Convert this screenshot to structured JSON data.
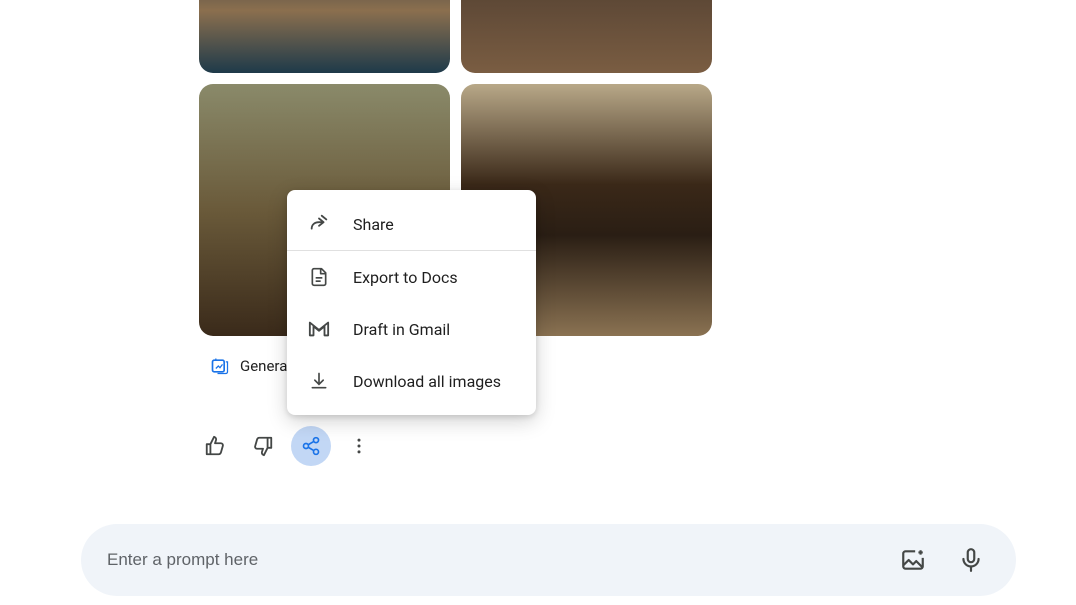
{
  "popup": {
    "share": "Share",
    "export_docs": "Export to Docs",
    "draft_gmail": "Draft in Gmail",
    "download_all": "Download all images"
  },
  "gen_label": "Genera",
  "prompt": {
    "placeholder": "Enter a prompt here"
  }
}
